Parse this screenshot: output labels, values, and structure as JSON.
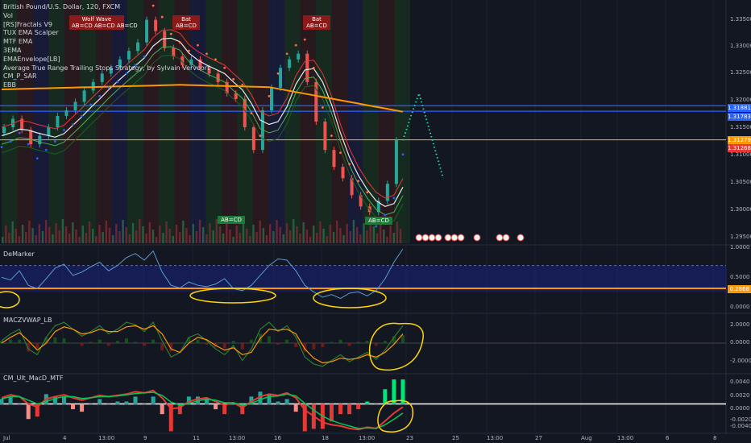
{
  "legend": {
    "title": "British Pound/U.S. Dollar, 120, FXCM",
    "indicators": [
      "Vol",
      "[RS]Fractals V9",
      "TUX EMA Scalper",
      "MTF EMA",
      "3EMA",
      "EMAEnvelope[LB]",
      "Average True Range Trailing Stops Strategy, by Sylvain Vervoort",
      "CM_P_SAR",
      "EBB"
    ]
  },
  "panes": {
    "demarker": "DeMarker",
    "macd_vwap": "MACZVWAP_LB",
    "macd_mtf": "CM_Ult_MacD_MTF"
  },
  "pattern_tags": [
    {
      "text": "Wolf Wave",
      "style": "red"
    },
    {
      "text": "AB=CD AB=CD AB=CD",
      "style": "red"
    },
    {
      "text": "Bat",
      "style": "red"
    },
    {
      "text": "AB=CD",
      "style": "red"
    },
    {
      "text": "Bat",
      "style": "red"
    },
    {
      "text": "AB=CD",
      "style": "red"
    },
    {
      "text": "AB=CD",
      "style": "green"
    },
    {
      "text": "AB=CD",
      "style": "green"
    }
  ],
  "price_tags": [
    {
      "text": "1.31881",
      "bg": "#2962ff"
    },
    {
      "text": "1.31783",
      "bg": "#2962ff"
    },
    {
      "text": "1.31279",
      "bg": "#ff9800"
    },
    {
      "text": "1.31268",
      "bg": "#e53935"
    }
  ],
  "chart_data": {
    "type": "line",
    "title": "British Pound/U.S. Dollar, 120, FXCM",
    "main_axis_ticks": [
      "1.33500",
      "1.33000",
      "1.32500",
      "1.32000",
      "1.31500",
      "1.31000",
      "1.30500",
      "1.30000",
      "1.29500"
    ],
    "main_ylim": [
      1.2945,
      1.3375
    ],
    "horizontal_levels": [
      {
        "value": 1.31881,
        "color": "#2962ff"
      },
      {
        "value": 1.31783,
        "color": "#2962ff"
      },
      {
        "value": 1.31279,
        "color": "#ff9800"
      }
    ],
    "price_series": [
      1.314,
      1.315,
      1.3165,
      1.3145,
      1.312,
      1.3135,
      1.315,
      1.317,
      1.318,
      1.3195,
      1.3215,
      1.323,
      1.3245,
      1.3255,
      1.327,
      1.3285,
      1.33,
      1.334,
      1.332,
      1.329,
      1.3275,
      1.326,
      1.327,
      1.3255,
      1.3245,
      1.323,
      1.321,
      1.32,
      1.315,
      1.311,
      1.318,
      1.322,
      1.3255,
      1.327,
      1.328,
      1.323,
      1.316,
      1.311,
      1.308,
      1.306,
      1.303,
      1.301,
      1.3,
      1.302,
      1.305,
      1.3127
    ],
    "projection": [
      1.3127,
      1.317,
      1.321,
      1.316,
      1.311,
      1.306
    ],
    "demarker": {
      "axis_ticks": [
        "1.0000",
        "0.5000",
        "0.0000"
      ],
      "level": "0.2868",
      "ylim": [
        0,
        1
      ],
      "values": [
        0.52,
        0.48,
        0.62,
        0.4,
        0.35,
        0.5,
        0.66,
        0.72,
        0.55,
        0.6,
        0.68,
        0.75,
        0.62,
        0.7,
        0.82,
        0.88,
        0.78,
        0.92,
        0.6,
        0.4,
        0.36,
        0.45,
        0.4,
        0.38,
        0.42,
        0.5,
        0.35,
        0.32,
        0.4,
        0.55,
        0.7,
        0.8,
        0.78,
        0.62,
        0.4,
        0.3,
        0.22,
        0.26,
        0.2,
        0.28,
        0.3,
        0.24,
        0.32,
        0.5,
        0.75,
        0.95
      ]
    },
    "macd_vwap": {
      "axis_ticks": [
        "2.0000",
        "0.0000",
        "-2.0000"
      ],
      "ylim": [
        -2.5,
        2.5
      ],
      "line1": [
        0.2,
        0.8,
        1.2,
        -0.5,
        -1.0,
        0.5,
        1.5,
        1.8,
        1.2,
        0.6,
        1.0,
        1.5,
        0.8,
        1.2,
        1.8,
        1.6,
        1.0,
        1.8,
        0.2,
        -1.2,
        -0.8,
        0.5,
        0.8,
        0.2,
        -0.5,
        -1.0,
        -0.2,
        -1.5,
        -0.5,
        1.2,
        1.8,
        1.0,
        1.5,
        0.5,
        -1.2,
        -1.8,
        -2.0,
        -1.5,
        -1.0,
        -1.6,
        -1.2,
        -0.8,
        -1.4,
        -0.6,
        0.5,
        1.5
      ],
      "line2": [
        0.0,
        0.5,
        0.9,
        0.2,
        -0.6,
        0.0,
        1.0,
        1.4,
        1.2,
        0.8,
        0.9,
        1.2,
        1.0,
        1.0,
        1.4,
        1.5,
        1.2,
        1.5,
        0.8,
        -0.5,
        -0.8,
        0.0,
        0.5,
        0.3,
        -0.2,
        -0.6,
        -0.4,
        -1.0,
        -0.8,
        0.4,
        1.2,
        1.1,
        1.2,
        0.8,
        -0.5,
        -1.3,
        -1.7,
        -1.6,
        -1.3,
        -1.4,
        -1.3,
        -1.0,
        -1.2,
        -0.8,
        -0.1,
        0.8
      ]
    },
    "macd_mtf": {
      "axis_ticks": [
        "0.0040",
        "0.0020",
        "0.0000",
        "-0.0020",
        "-0.0040"
      ],
      "ylim": [
        -0.0048,
        0.0048
      ],
      "macd": [
        0.001,
        0.0015,
        0.0012,
        0.0,
        -0.0005,
        0.0008,
        0.0012,
        0.0015,
        0.001,
        0.0006,
        0.001,
        0.0014,
        0.0012,
        0.0014,
        0.0016,
        0.002,
        0.0018,
        0.0022,
        0.001,
        -0.0008,
        -0.0006,
        0.0004,
        0.0008,
        0.001,
        0.0004,
        -0.0002,
        0.0002,
        -0.0006,
        0.0004,
        0.0012,
        0.0016,
        0.0014,
        0.0018,
        0.001,
        -0.001,
        -0.002,
        -0.003,
        -0.0034,
        -0.0036,
        -0.004,
        -0.0042,
        -0.0038,
        -0.004,
        -0.0028,
        -0.0015,
        -0.0005
      ],
      "signal": [
        0.0008,
        0.0012,
        0.0012,
        0.0006,
        0.0,
        0.0004,
        0.0009,
        0.0012,
        0.0012,
        0.0009,
        0.001,
        0.0012,
        0.0012,
        0.0013,
        0.0015,
        0.0017,
        0.0018,
        0.0019,
        0.0014,
        0.0003,
        -0.0002,
        0.0001,
        0.0005,
        0.0008,
        0.0006,
        0.0002,
        0.0002,
        -0.0002,
        0.0001,
        0.0007,
        0.0012,
        0.0013,
        0.0016,
        0.0013,
        0.0001,
        -0.001,
        -0.002,
        -0.0027,
        -0.0032,
        -0.0036,
        -0.004,
        -0.0039,
        -0.004,
        -0.0034,
        -0.0025,
        -0.0015
      ]
    },
    "time_labels": [
      "Jul",
      "4",
      "13:00",
      "9",
      "11",
      "13:00",
      "16",
      "18",
      "13:00",
      "23",
      "25",
      "13:00",
      "27",
      "Aug",
      "13:00",
      "6",
      "8"
    ]
  }
}
